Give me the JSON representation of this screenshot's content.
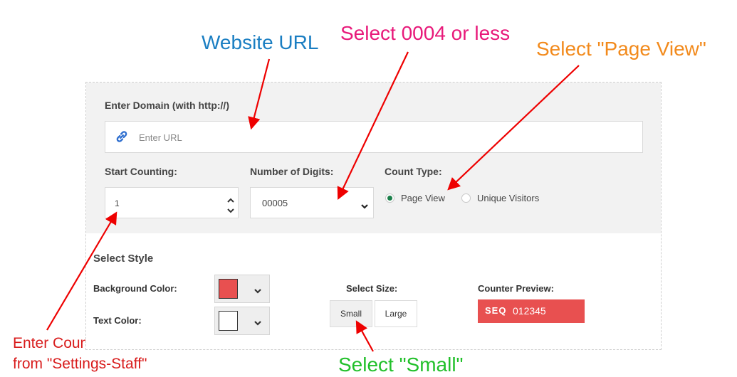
{
  "annotations": {
    "website_url": "Website URL",
    "select_digits": "Select 0004 or less",
    "select_page_view": "Select \"Page View\"",
    "enter_counter_line1": "Enter Counter number",
    "enter_counter_line2": "from \"Settings-Staff\"",
    "select_small": "Select \"Small\"",
    "colors": {
      "website_url": "#1a7ec2",
      "select_digits": "#e8197a",
      "select_page_view": "#f28a1c",
      "enter_counter": "#d81b1b",
      "select_small": "#21c02a",
      "arrow": "#ee0000"
    }
  },
  "form": {
    "domain_label": "Enter Domain (with http://)",
    "domain_placeholder": "Enter URL",
    "domain_icon": "link-icon",
    "start_counting_label": "Start Counting:",
    "start_counting_value": "1",
    "digits_label": "Number of Digits:",
    "digits_value": "00005",
    "count_type_label": "Count Type:",
    "count_type_options": [
      "Page View",
      "Unique Visitors"
    ],
    "count_type_selected": "Page View"
  },
  "style": {
    "section_title": "Select Style",
    "bg_color_label": "Background Color:",
    "bg_color_value": "#e85050",
    "text_color_label": "Text Color:",
    "text_color_value": "#ffffff",
    "size_label": "Select Size:",
    "size_options": [
      "Small",
      "Large"
    ],
    "size_selected": "Small",
    "preview_label": "Counter Preview:",
    "preview_logo": "SEQ",
    "preview_value": "012345",
    "preview_bg": "#e85050"
  }
}
